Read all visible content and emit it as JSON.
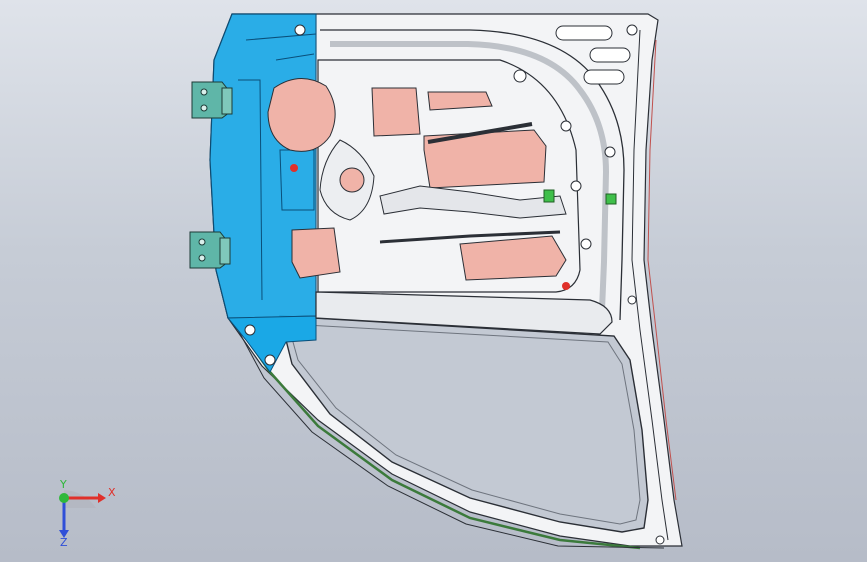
{
  "viewport": {
    "background_top": "#dfe3ea",
    "background_bottom": "#b6bcc8"
  },
  "model": {
    "part": "car-door-inner-panel",
    "highlight_color": "#1aa8e6",
    "panel_color": "#f3f4f6",
    "cutout_color": "#f0b3a8",
    "edge_color": "#2b2f36",
    "seal_color": "#3b7a3b",
    "hinge_color": "#5fb6a8"
  },
  "triad": {
    "x_label": "X",
    "y_label": "Y",
    "z_label": "Z",
    "x_color": "#e0302a",
    "y_color": "#2fb83a",
    "z_color": "#2f4fd8"
  }
}
